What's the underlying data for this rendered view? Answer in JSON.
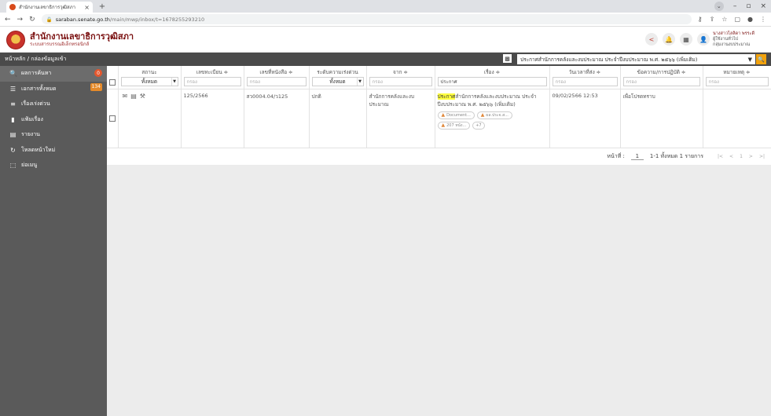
{
  "browser": {
    "tab_title": "สำนักงานเลขาธิการวุฒิสภา",
    "url_host": "saraban.senate.go.th",
    "url_path": "/main/mwp/inbox/t=1678255293210"
  },
  "app": {
    "title": "สำนักงานเลขาธิการวุฒิสภา",
    "subtitle": "ระบบสารบรรณอิเล็กทรอนิกส์",
    "user_name": "นางสาวไลลิดา พรระดี",
    "user_role": "ผู้ใช้งานทั่วไป",
    "user_dept": "กลุ่มงานงบประมาณ"
  },
  "breadcrumb": "หน้าหลัก / กล่องข้อมูลเข้า",
  "search": {
    "value": "ประกาศสำนักการคลังและงบประมาณ ประจำปีงบประมาณ พ.ศ. ๒๕๖๖ (เพิ่มเติม)"
  },
  "sidebar": {
    "items": [
      {
        "label": "ผลการค้นหา",
        "icon": "search-icon",
        "badge": "0"
      },
      {
        "label": "เอกสารทั้งหมด",
        "icon": "list-icon",
        "badge": "134"
      },
      {
        "label": "เรื่องเร่งด่วน",
        "icon": "filter-icon",
        "badge": ""
      },
      {
        "label": "แฟ้มเรื่อง",
        "icon": "folder-icon",
        "badge": ""
      },
      {
        "label": "รายงาน",
        "icon": "report-icon",
        "badge": ""
      },
      {
        "label": "โหลดหน้าใหม่",
        "icon": "reload-icon",
        "badge": ""
      },
      {
        "label": "ย่อเมนู",
        "icon": "collapse-icon",
        "badge": ""
      }
    ]
  },
  "table": {
    "headers": {
      "status": "สถานะ",
      "reg_no": "เลขทะเบียน ≑",
      "doc_no": "เลขที่หนังสือ ≑",
      "urgency": "ระดับความเร่งด่วน",
      "from": "จาก ≑",
      "subject": "เรื่อง ≑",
      "sent_at": "วันเวลาที่ส่ง ≑",
      "action": "ข้อความ/การปฏิบัติ ≑",
      "note": "หมายเหตุ ≑"
    },
    "filters": {
      "status_value": "ทั้งหมด",
      "urgency_value": "ทั้งหมด",
      "placeholder": "กรอง",
      "subject_value": "ประกาศ"
    },
    "rows": [
      {
        "reg_no": "125/2566",
        "doc_no": "สว0004.04/ว125",
        "urgency": "ปกติ",
        "from": "สำนักการคลังและงบประมาณ",
        "subject_highlight": "ประกาศ",
        "subject_rest": "สำนักการคลังและงบประมาณ ประจำปีงบประมาณ พ.ศ. ๒๕๖๖ (เพิ่มเติม)",
        "attachments": [
          "Document...",
          "ผล.ประจ.ส...",
          "207 หนัง..."
        ],
        "more": "+7",
        "sent_at": "09/02/2566 12:53",
        "action": "เพื่อโปรดทราบ",
        "note": ""
      }
    ]
  },
  "pager": {
    "page_label": "หน้าที่ :",
    "page": "1",
    "summary": "1-1 ทั้งหมด 1 รายการ",
    "first": "|<",
    "prev": "<",
    "current": "1",
    "next": ">",
    "last": ">|"
  }
}
